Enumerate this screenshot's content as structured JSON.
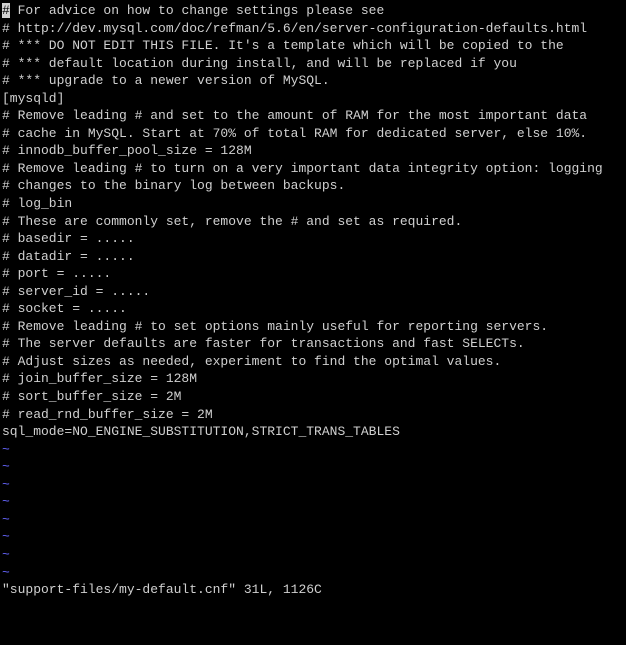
{
  "file_content": {
    "line01_first_char": "#",
    "line01_rest": " For advice on how to change settings please see",
    "line02": "# http://dev.mysql.com/doc/refman/5.6/en/server-configuration-defaults.html",
    "line03": "# *** DO NOT EDIT THIS FILE. It's a template which will be copied to the",
    "line04": "# *** default location during install, and will be replaced if you",
    "line05": "# *** upgrade to a newer version of MySQL.",
    "line06": "",
    "line07": "[mysqld]",
    "line08": "",
    "line09": "# Remove leading # and set to the amount of RAM for the most important data",
    "line10": "# cache in MySQL. Start at 70% of total RAM for dedicated server, else 10%.",
    "line11": "# innodb_buffer_pool_size = 128M",
    "line12": "",
    "line13": "# Remove leading # to turn on a very important data integrity option: logging",
    "line14": "# changes to the binary log between backups.",
    "line15": "# log_bin",
    "line16": "",
    "line17": "# These are commonly set, remove the # and set as required.",
    "line18": "# basedir = .....",
    "line19": "# datadir = .....",
    "line20": "# port = .....",
    "line21": "# server_id = .....",
    "line22": "# socket = .....",
    "line23": "",
    "line24": "# Remove leading # to set options mainly useful for reporting servers.",
    "line25": "# The server defaults are faster for transactions and fast SELECTs.",
    "line26": "# Adjust sizes as needed, experiment to find the optimal values.",
    "line27": "# join_buffer_size = 128M",
    "line28": "# sort_buffer_size = 2M",
    "line29": "# read_rnd_buffer_size = 2M",
    "line30": "",
    "line31": "sql_mode=NO_ENGINE_SUBSTITUTION,STRICT_TRANS_TABLES"
  },
  "tildes": {
    "t1": "~",
    "t2": "~",
    "t3": "~",
    "t4": "~",
    "t5": "~",
    "t6": "~",
    "t7": "~",
    "t8": "~"
  },
  "status_line": "\"support-files/my-default.cnf\" 31L, 1126C"
}
